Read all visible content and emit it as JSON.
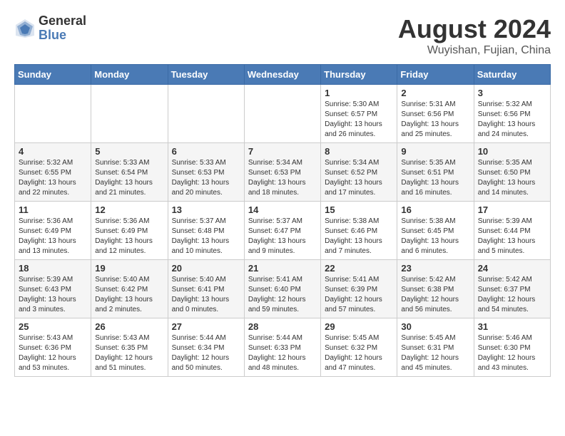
{
  "header": {
    "logo_general": "General",
    "logo_blue": "Blue",
    "month_title": "August 2024",
    "location": "Wuyishan, Fujian, China"
  },
  "days_of_week": [
    "Sunday",
    "Monday",
    "Tuesday",
    "Wednesday",
    "Thursday",
    "Friday",
    "Saturday"
  ],
  "weeks": [
    [
      {
        "day": "",
        "info": ""
      },
      {
        "day": "",
        "info": ""
      },
      {
        "day": "",
        "info": ""
      },
      {
        "day": "",
        "info": ""
      },
      {
        "day": "1",
        "info": "Sunrise: 5:30 AM\nSunset: 6:57 PM\nDaylight: 13 hours\nand 26 minutes."
      },
      {
        "day": "2",
        "info": "Sunrise: 5:31 AM\nSunset: 6:56 PM\nDaylight: 13 hours\nand 25 minutes."
      },
      {
        "day": "3",
        "info": "Sunrise: 5:32 AM\nSunset: 6:56 PM\nDaylight: 13 hours\nand 24 minutes."
      }
    ],
    [
      {
        "day": "4",
        "info": "Sunrise: 5:32 AM\nSunset: 6:55 PM\nDaylight: 13 hours\nand 22 minutes."
      },
      {
        "day": "5",
        "info": "Sunrise: 5:33 AM\nSunset: 6:54 PM\nDaylight: 13 hours\nand 21 minutes."
      },
      {
        "day": "6",
        "info": "Sunrise: 5:33 AM\nSunset: 6:53 PM\nDaylight: 13 hours\nand 20 minutes."
      },
      {
        "day": "7",
        "info": "Sunrise: 5:34 AM\nSunset: 6:53 PM\nDaylight: 13 hours\nand 18 minutes."
      },
      {
        "day": "8",
        "info": "Sunrise: 5:34 AM\nSunset: 6:52 PM\nDaylight: 13 hours\nand 17 minutes."
      },
      {
        "day": "9",
        "info": "Sunrise: 5:35 AM\nSunset: 6:51 PM\nDaylight: 13 hours\nand 16 minutes."
      },
      {
        "day": "10",
        "info": "Sunrise: 5:35 AM\nSunset: 6:50 PM\nDaylight: 13 hours\nand 14 minutes."
      }
    ],
    [
      {
        "day": "11",
        "info": "Sunrise: 5:36 AM\nSunset: 6:49 PM\nDaylight: 13 hours\nand 13 minutes."
      },
      {
        "day": "12",
        "info": "Sunrise: 5:36 AM\nSunset: 6:49 PM\nDaylight: 13 hours\nand 12 minutes."
      },
      {
        "day": "13",
        "info": "Sunrise: 5:37 AM\nSunset: 6:48 PM\nDaylight: 13 hours\nand 10 minutes."
      },
      {
        "day": "14",
        "info": "Sunrise: 5:37 AM\nSunset: 6:47 PM\nDaylight: 13 hours\nand 9 minutes."
      },
      {
        "day": "15",
        "info": "Sunrise: 5:38 AM\nSunset: 6:46 PM\nDaylight: 13 hours\nand 7 minutes."
      },
      {
        "day": "16",
        "info": "Sunrise: 5:38 AM\nSunset: 6:45 PM\nDaylight: 13 hours\nand 6 minutes."
      },
      {
        "day": "17",
        "info": "Sunrise: 5:39 AM\nSunset: 6:44 PM\nDaylight: 13 hours\nand 5 minutes."
      }
    ],
    [
      {
        "day": "18",
        "info": "Sunrise: 5:39 AM\nSunset: 6:43 PM\nDaylight: 13 hours\nand 3 minutes."
      },
      {
        "day": "19",
        "info": "Sunrise: 5:40 AM\nSunset: 6:42 PM\nDaylight: 13 hours\nand 2 minutes."
      },
      {
        "day": "20",
        "info": "Sunrise: 5:40 AM\nSunset: 6:41 PM\nDaylight: 13 hours\nand 0 minutes."
      },
      {
        "day": "21",
        "info": "Sunrise: 5:41 AM\nSunset: 6:40 PM\nDaylight: 12 hours\nand 59 minutes."
      },
      {
        "day": "22",
        "info": "Sunrise: 5:41 AM\nSunset: 6:39 PM\nDaylight: 12 hours\nand 57 minutes."
      },
      {
        "day": "23",
        "info": "Sunrise: 5:42 AM\nSunset: 6:38 PM\nDaylight: 12 hours\nand 56 minutes."
      },
      {
        "day": "24",
        "info": "Sunrise: 5:42 AM\nSunset: 6:37 PM\nDaylight: 12 hours\nand 54 minutes."
      }
    ],
    [
      {
        "day": "25",
        "info": "Sunrise: 5:43 AM\nSunset: 6:36 PM\nDaylight: 12 hours\nand 53 minutes."
      },
      {
        "day": "26",
        "info": "Sunrise: 5:43 AM\nSunset: 6:35 PM\nDaylight: 12 hours\nand 51 minutes."
      },
      {
        "day": "27",
        "info": "Sunrise: 5:44 AM\nSunset: 6:34 PM\nDaylight: 12 hours\nand 50 minutes."
      },
      {
        "day": "28",
        "info": "Sunrise: 5:44 AM\nSunset: 6:33 PM\nDaylight: 12 hours\nand 48 minutes."
      },
      {
        "day": "29",
        "info": "Sunrise: 5:45 AM\nSunset: 6:32 PM\nDaylight: 12 hours\nand 47 minutes."
      },
      {
        "day": "30",
        "info": "Sunrise: 5:45 AM\nSunset: 6:31 PM\nDaylight: 12 hours\nand 45 minutes."
      },
      {
        "day": "31",
        "info": "Sunrise: 5:46 AM\nSunset: 6:30 PM\nDaylight: 12 hours\nand 43 minutes."
      }
    ]
  ]
}
